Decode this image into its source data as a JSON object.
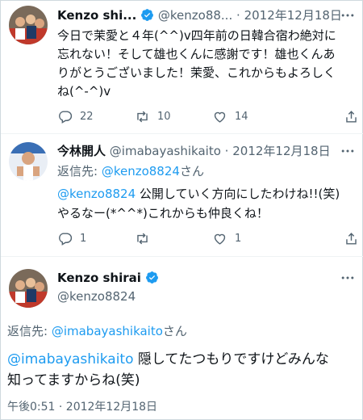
{
  "tweet1": {
    "name": "Kenzo shi...",
    "handle": "@kenzo88...",
    "sep": "·",
    "date": "2012年12月18日",
    "text_lines": [
      "今日で茉愛と４年(^^)v四年前の日韓合宿わ絶対に",
      "忘れない！そして雄也くんに感謝です！雄也くんあ",
      "りがとうございました！茉愛、これからもよろしく",
      "ね(^-^)v"
    ],
    "replies": "22",
    "retweets": "10",
    "likes": "14"
  },
  "tweet2": {
    "name": "今林開人",
    "handle": "@imabayashikaito",
    "sep": "·",
    "date": "2012年12月18日",
    "replying_prefix": "返信先: ",
    "replying_handle": "@kenzo8824",
    "replying_suffix": "さん",
    "mention": "@kenzo8824",
    "text_line1_rest": " 公開していく方向にしたわけね!!(笑)",
    "text_line2": "やるなー(*^^*)これからも仲良くね！",
    "replies": "1",
    "retweets": "",
    "likes": "1"
  },
  "tweet3": {
    "name": "Kenzo shirai",
    "handle": "@kenzo8824",
    "replying_prefix": "返信先: ",
    "replying_handle": "@imabayashikaito",
    "replying_suffix": "さん",
    "mention": "@imabayashikaito",
    "text_line1_rest": " 隠してたつもりですけどみんな",
    "text_line2": "知ってますからね(笑)",
    "timestamp": "午後0:51 · 2012年12月18日"
  },
  "colors": {
    "accent": "#1d9bf0",
    "muted": "#536471",
    "text": "#0f1419",
    "divider": "#eff3f4"
  },
  "icons": [
    "reply-icon",
    "retweet-icon",
    "like-icon",
    "share-icon",
    "verified-badge-icon",
    "more-icon"
  ]
}
